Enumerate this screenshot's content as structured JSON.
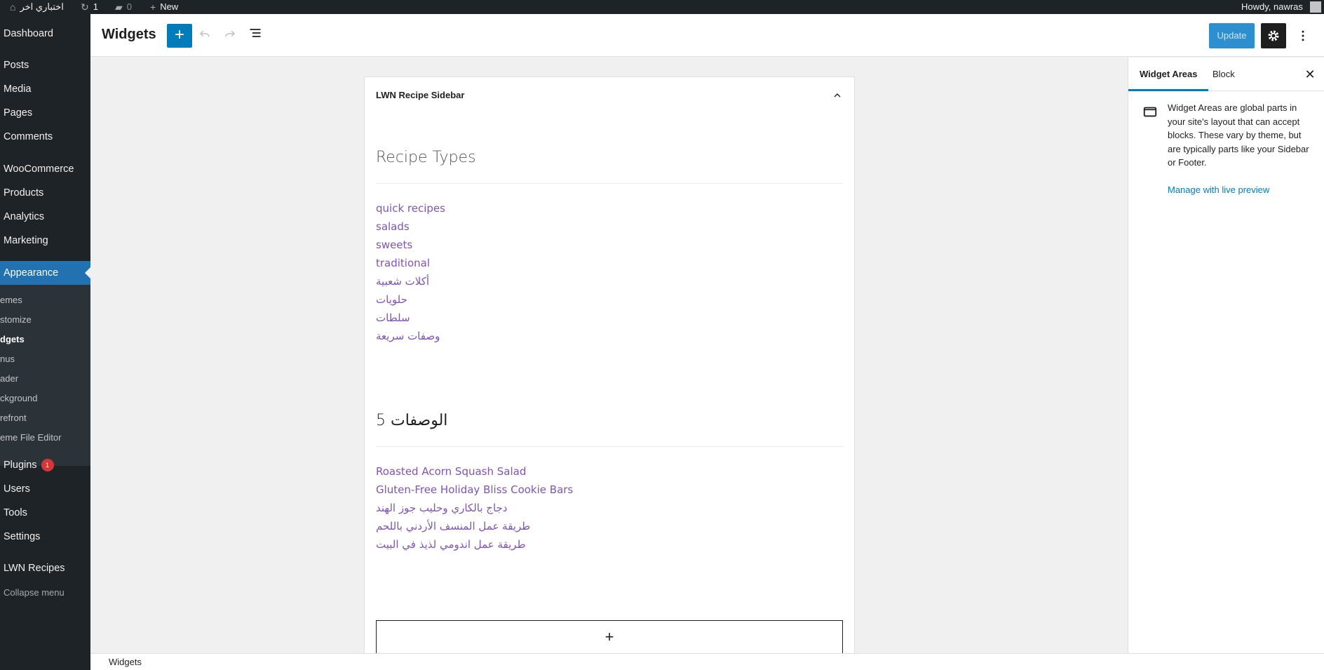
{
  "admin_bar": {
    "site_name": "اختباري اخر",
    "updates_count": "1",
    "comments_count": "0",
    "new_label": "New",
    "howdy": "Howdy, nawras"
  },
  "menu": {
    "dashboard": "Dashboard",
    "posts": "Posts",
    "media": "Media",
    "pages": "Pages",
    "comments": "Comments",
    "woocommerce": "WooCommerce",
    "products": "Products",
    "analytics": "Analytics",
    "marketing": "Marketing",
    "appearance": "Appearance",
    "sub": [
      "emes",
      "stomize",
      "dgets",
      "nus",
      "ader",
      "ckground",
      "refront",
      "eme File Editor"
    ],
    "plugins": "Plugins",
    "plugins_badge": "1",
    "users": "Users",
    "tools": "Tools",
    "settings": "Settings",
    "lwn_recipes": "LWN Recipes",
    "collapse": "Collapse menu"
  },
  "header": {
    "title": "Widgets",
    "add_icon": "+",
    "update_label": "Update"
  },
  "widget_area": {
    "title": "LWN Recipe Sidebar",
    "block1_heading": "Recipe Types",
    "block1_links": [
      "quick recipes",
      "salads",
      "sweets",
      "traditional",
      "أكلات شعبية",
      "حلويات",
      "سلطات",
      "وصفات سريعة"
    ],
    "block2_heading": "الوصفات 5",
    "block2_links": [
      "Roasted Acorn Squash Salad",
      "Gluten-Free Holiday Bliss Cookie Bars",
      "دجاج بالكاري وحليب جوز الهند",
      "طريقة عمل المنسف الأردني باللحم",
      "طريقة عمل اندومي لذيذ في البيت"
    ],
    "appender_icon": "+"
  },
  "sidebar": {
    "tab_widget_areas": "Widget Areas",
    "tab_block": "Block",
    "description": "Widget Areas are global parts in your site's layout that can accept blocks. These vary by theme, but are typically parts like your Sidebar or Footer.",
    "manage_link": "Manage with live preview"
  },
  "footer": {
    "breadcrumb": "Widgets"
  },
  "colors": {
    "admin_dark": "#1d2327",
    "accent": "#007cba",
    "menu_current": "#2271b1",
    "link_purple": "#7f54b3",
    "badge_red": "#d63638"
  }
}
